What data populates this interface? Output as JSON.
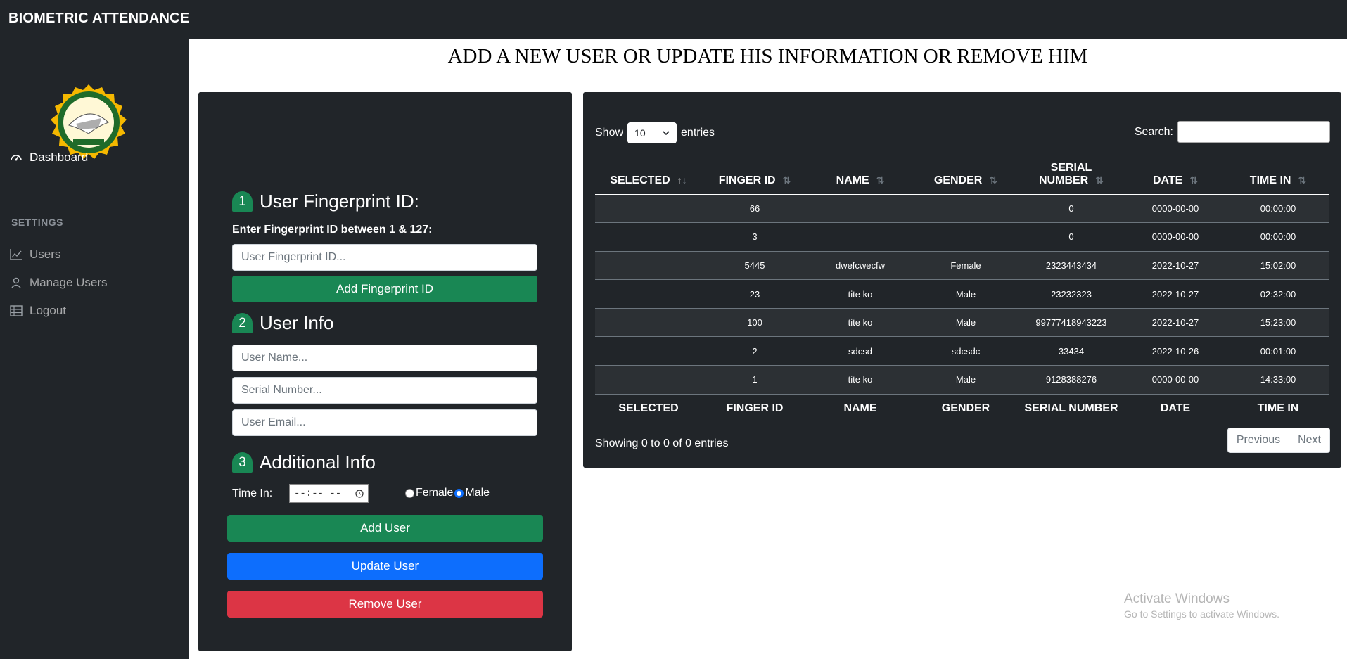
{
  "app": {
    "brand": "BIOMETRIC ATTENDANCE"
  },
  "sidebar": {
    "items": [
      {
        "label": "Dashboard",
        "icon": "gauge-icon"
      }
    ],
    "settings_heading": "SETTINGS",
    "settings_items": [
      {
        "label": "Users",
        "icon": "chart-line-icon"
      },
      {
        "label": "Manage Users",
        "icon": "person-icon"
      },
      {
        "label": "Logout",
        "icon": "table-icon"
      }
    ]
  },
  "page": {
    "title": "ADD A NEW USER OR UPDATE HIS INFORMATION OR REMOVE HIM"
  },
  "form": {
    "step1": {
      "number": "1",
      "title": "User Fingerprint ID:"
    },
    "fingerprint_label": "Enter Fingerprint ID between 1 & 127:",
    "fingerprint_placeholder": "User Fingerprint ID...",
    "add_fingerprint_button": "Add Fingerprint ID",
    "step2": {
      "number": "2",
      "title": "User Info"
    },
    "name_placeholder": "User Name...",
    "serial_placeholder": "Serial Number...",
    "email_placeholder": "User Email...",
    "step3": {
      "number": "3",
      "title": "Additional Info"
    },
    "time_label": "Time In:",
    "time_placeholder": "--:-- --",
    "gender_female": "Female",
    "gender_male": "Male",
    "add_user_button": "Add User",
    "update_user_button": "Update User",
    "remove_user_button": "Remove User"
  },
  "table": {
    "show_label": "Show",
    "entries_label": "entries",
    "page_size": "10",
    "search_label": "Search:",
    "columns": [
      "SELECTED",
      "FINGER ID",
      "NAME",
      "GENDER",
      "SERIAL NUMBER",
      "DATE",
      "TIME IN"
    ],
    "rows": [
      [
        "",
        "66",
        "",
        "",
        "0",
        "0000-00-00",
        "00:00:00"
      ],
      [
        "",
        "3",
        "",
        "",
        "0",
        "0000-00-00",
        "00:00:00"
      ],
      [
        "",
        "5445",
        "dwefcwecfw",
        "Female",
        "2323443434",
        "2022-10-27",
        "15:02:00"
      ],
      [
        "",
        "23",
        "tite ko",
        "Male",
        "23232323",
        "2022-10-27",
        "02:32:00"
      ],
      [
        "",
        "100",
        "tite ko",
        "Male",
        "99777418943223",
        "2022-10-27",
        "15:23:00"
      ],
      [
        "",
        "2",
        "sdcsd",
        "sdcsdc",
        "33434",
        "2022-10-26",
        "00:01:00"
      ],
      [
        "",
        "1",
        "tite ko",
        "Male",
        "9128388276",
        "0000-00-00",
        "14:33:00"
      ]
    ],
    "info": "Showing 0 to 0 of 0 entries",
    "previous": "Previous",
    "next": "Next"
  },
  "watermark": {
    "line1": "Activate Windows",
    "line2": "Go to Settings to activate Windows."
  },
  "colors": {
    "dark": "#212529",
    "green": "#198754",
    "blue": "#0d6efd",
    "red": "#dc3545"
  }
}
